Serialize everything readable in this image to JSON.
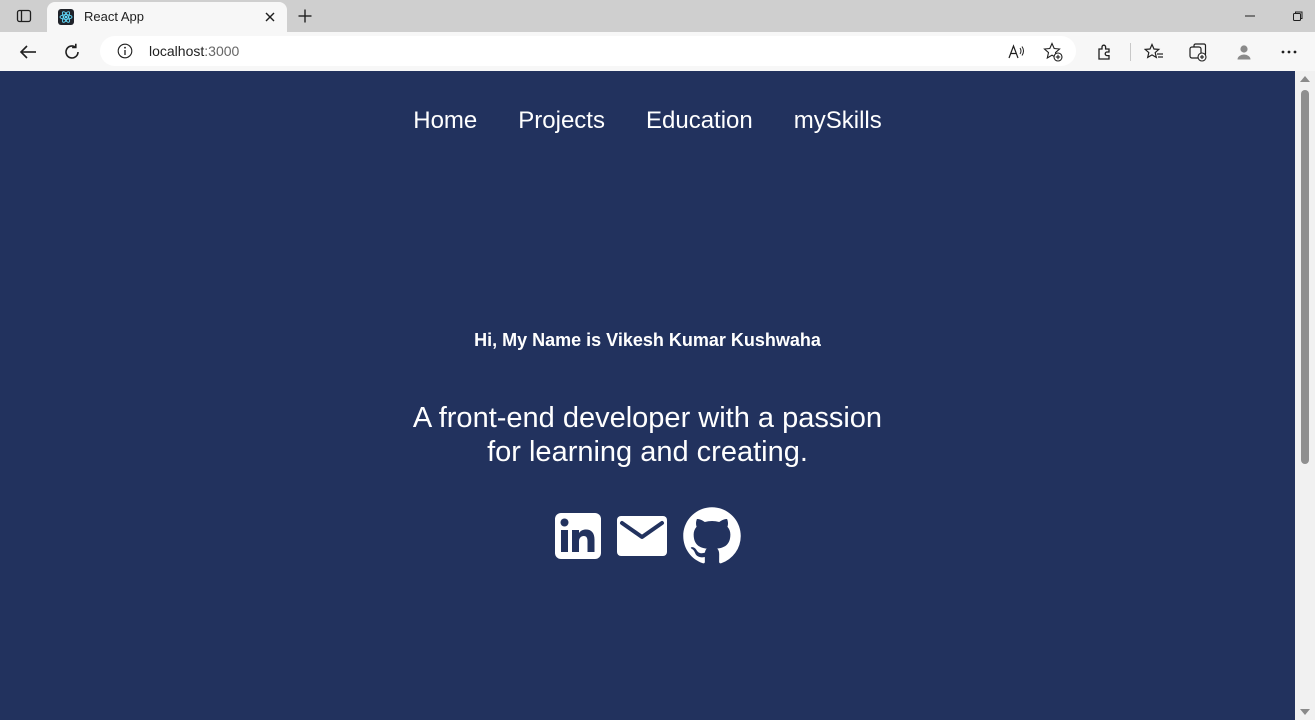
{
  "browser": {
    "tab": {
      "title": "React App",
      "favicon": "react-logo-icon"
    },
    "address": {
      "host": "localhost",
      "port": ":3000"
    },
    "icons": [
      "tab-actions-icon",
      "close-icon",
      "plus-icon",
      "minimize-icon",
      "restore-icon",
      "back-arrow-icon",
      "refresh-icon",
      "info-icon",
      "read-aloud-icon",
      "add-favorite-icon",
      "extensions-icon",
      "favorites-icon",
      "collections-icon",
      "profile-icon",
      "more-icon"
    ]
  },
  "page": {
    "nav": {
      "items": [
        "Home",
        "Projects",
        "Education",
        "mySkills"
      ]
    },
    "intro": "Hi, My Name is Vikesh Kumar Kushwaha",
    "tagline": {
      "line1": "A front-end developer with a passion",
      "line2": "for learning and creating."
    },
    "socials": [
      "linkedin-icon",
      "mail-icon",
      "github-icon"
    ]
  },
  "colors": {
    "page_background": "#22325e",
    "text": "#ffffff",
    "chrome_tabbar": "#cfcfcf",
    "chrome_toolbar": "#f7f7f7"
  }
}
